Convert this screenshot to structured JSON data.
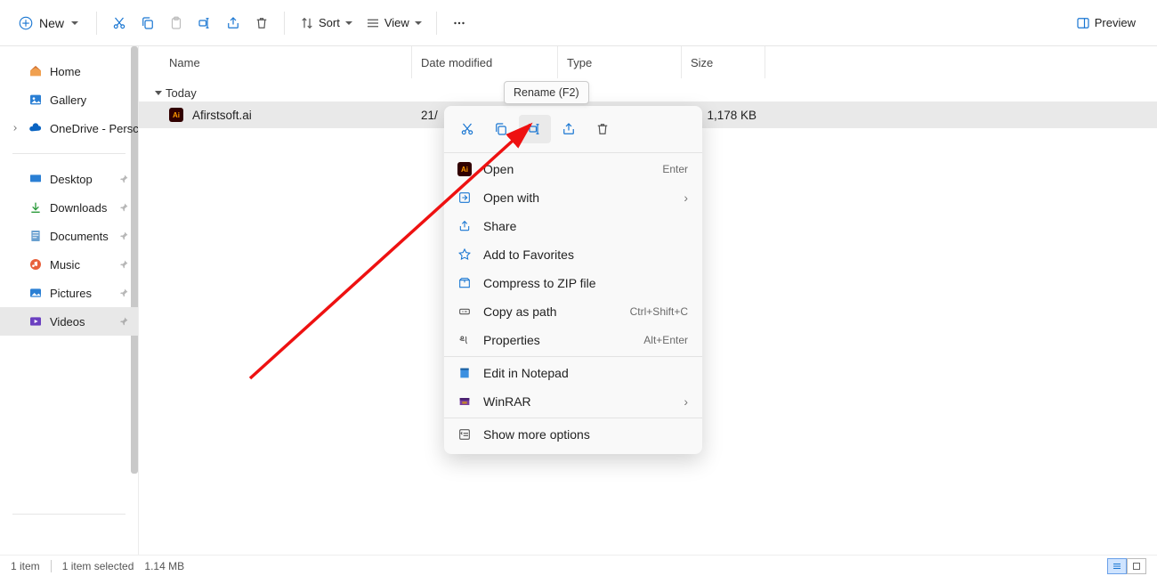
{
  "toolbar": {
    "new_label": "New",
    "sort_label": "Sort",
    "view_label": "View",
    "preview_label": "Preview"
  },
  "sidebar": {
    "home": "Home",
    "gallery": "Gallery",
    "onedrive": "OneDrive - Persc",
    "desktop": "Desktop",
    "downloads": "Downloads",
    "documents": "Documents",
    "music": "Music",
    "pictures": "Pictures",
    "videos": "Videos"
  },
  "columns": {
    "name": "Name",
    "date": "Date modified",
    "type": "Type",
    "size": "Size"
  },
  "group_today": "Today",
  "file": {
    "name": "Afirstsoft.ai",
    "date": "21/",
    "size": "1,178 KB",
    "icon_text": "Ai"
  },
  "tooltip": "Rename (F2)",
  "ctx": {
    "open": "Open",
    "open_sc": "Enter",
    "open_with": "Open with",
    "share": "Share",
    "favorites": "Add to Favorites",
    "zip": "Compress to ZIP file",
    "copy_path": "Copy as path",
    "copy_path_sc": "Ctrl+Shift+C",
    "properties": "Properties",
    "properties_sc": "Alt+Enter",
    "notepad": "Edit in Notepad",
    "winrar": "WinRAR",
    "more": "Show more options"
  },
  "status": {
    "count": "1 item",
    "selected": "1 item selected",
    "size": "1.14 MB"
  }
}
